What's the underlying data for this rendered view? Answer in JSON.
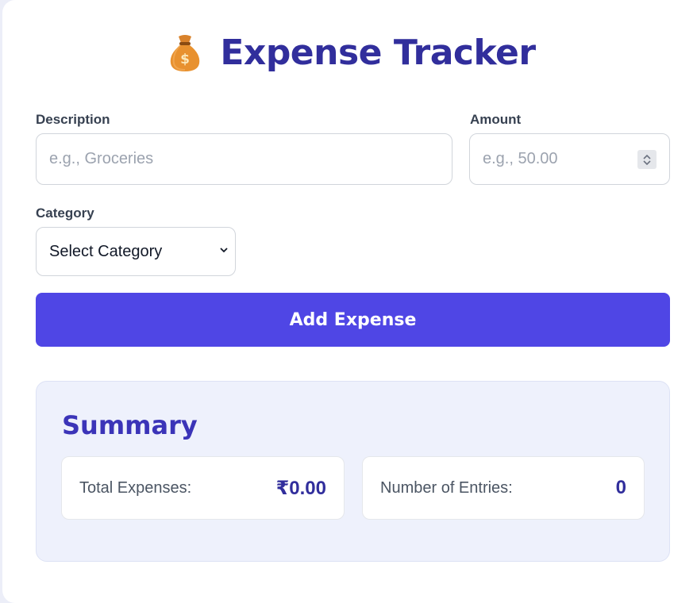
{
  "app": {
    "icon": "money-bag-icon",
    "title": "Expense Tracker"
  },
  "form": {
    "description": {
      "label": "Description",
      "placeholder": "e.g., Groceries",
      "value": ""
    },
    "amount": {
      "label": "Amount",
      "placeholder": "e.g., 50.00",
      "value": ""
    },
    "category": {
      "label": "Category",
      "selected": "Select Category"
    },
    "submit_label": "Add Expense"
  },
  "summary": {
    "title": "Summary",
    "total": {
      "label": "Total Expenses:",
      "value": "₹0.00"
    },
    "entries": {
      "label": "Number of Entries:",
      "value": "0"
    }
  },
  "colors": {
    "accent": "#4f46e5",
    "title": "#312e9c",
    "summary_bg": "#eef1fc"
  }
}
